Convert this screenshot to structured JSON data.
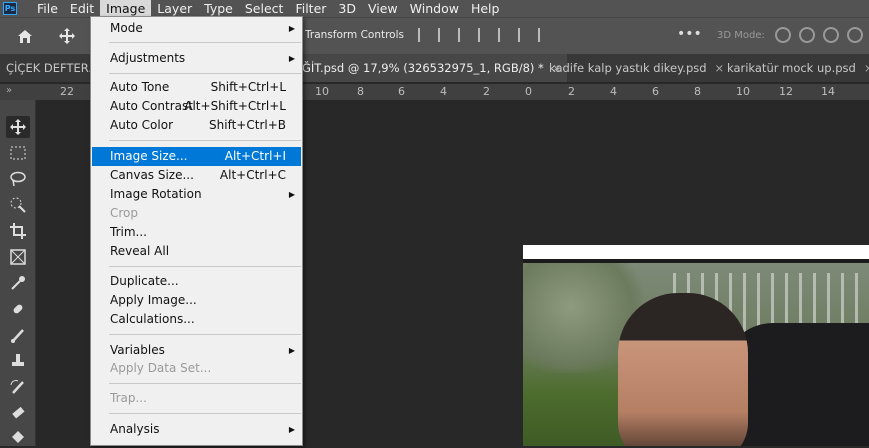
{
  "app": {
    "logo": "Ps"
  },
  "menubar": {
    "items": [
      "File",
      "Edit",
      "Image",
      "Layer",
      "Type",
      "Select",
      "Filter",
      "3D",
      "View",
      "Window",
      "Help"
    ],
    "active": "Image"
  },
  "options": {
    "transform_label": "Transform Controls",
    "mode_label": "3D Mode:",
    "more": "•••"
  },
  "tabs": [
    {
      "label": "ÇİÇEK DEFTER.p",
      "active": false
    },
    {
      "label": "ĞİT.psd @ 17,9% (326532975_1, RGB/8) *",
      "active": true,
      "close": "×"
    },
    {
      "label": "kadife kalp yastık dikey.psd",
      "active": false,
      "close": "×"
    },
    {
      "label": "karikatür mock up.psd",
      "active": false,
      "close": "×"
    }
  ],
  "ruler": {
    "corner": "»",
    "ticks": [
      "22",
      "10",
      "8",
      "6",
      "4",
      "2",
      "0",
      "2",
      "4",
      "6",
      "8",
      "10",
      "12",
      "14"
    ]
  },
  "image_menu": {
    "items": [
      {
        "label": "Mode",
        "submenu": true
      },
      {
        "separator": true
      },
      {
        "label": "Adjustments",
        "submenu": true
      },
      {
        "separator": true
      },
      {
        "label": "Auto Tone",
        "shortcut": "Shift+Ctrl+L"
      },
      {
        "label": "Auto Contrast",
        "shortcut": "Alt+Shift+Ctrl+L"
      },
      {
        "label": "Auto Color",
        "shortcut": "Shift+Ctrl+B"
      },
      {
        "separator": true
      },
      {
        "label": "Image Size...",
        "shortcut": "Alt+Ctrl+I",
        "highlighted": true
      },
      {
        "label": "Canvas Size...",
        "shortcut": "Alt+Ctrl+C"
      },
      {
        "label": "Image Rotation",
        "submenu": true
      },
      {
        "label": "Crop",
        "disabled": true
      },
      {
        "label": "Trim..."
      },
      {
        "label": "Reveal All"
      },
      {
        "separator": true
      },
      {
        "label": "Duplicate..."
      },
      {
        "label": "Apply Image..."
      },
      {
        "label": "Calculations..."
      },
      {
        "separator": true
      },
      {
        "label": "Variables",
        "submenu": true
      },
      {
        "label": "Apply Data Set...",
        "disabled": true
      },
      {
        "separator": true
      },
      {
        "label": "Trap...",
        "disabled": true
      },
      {
        "separator": true
      },
      {
        "label": "Analysis",
        "submenu": true
      }
    ]
  },
  "tools": [
    "move-tool-icon",
    "marquee-tool-icon",
    "lasso-tool-icon",
    "quick-selection-tool-icon",
    "crop-tool-icon",
    "frame-tool-icon",
    "eyedropper-tool-icon",
    "healing-brush-tool-icon",
    "brush-tool-icon",
    "clone-stamp-tool-icon",
    "history-brush-tool-icon",
    "eraser-tool-icon",
    "paint-bucket-tool-icon"
  ]
}
